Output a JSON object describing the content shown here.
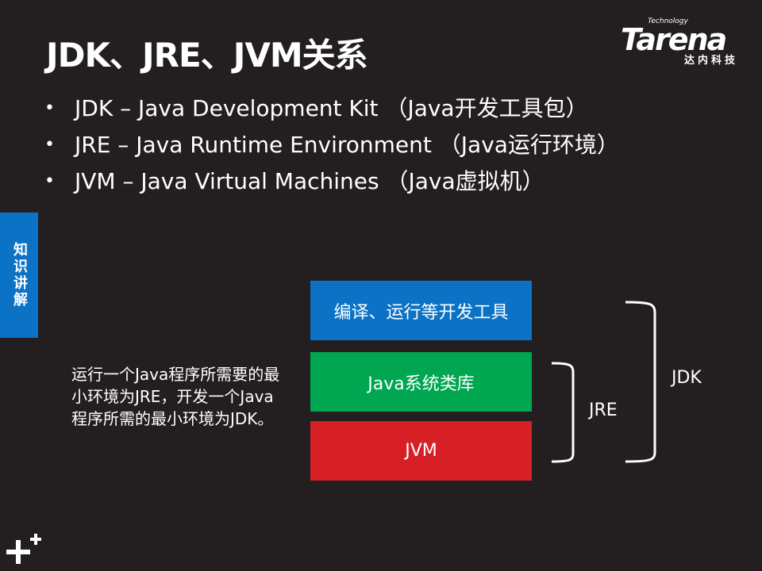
{
  "slide": {
    "title": "JDK、JRE、JVM关系",
    "bullets": [
      "JDK – Java Development Kit （Java开发工具包）",
      "JRE – Java Runtime Environment （Java运行环境）",
      "JVM – Java Virtual Machines （Java虚拟机）"
    ],
    "side_tab": "知识讲解",
    "note": "运行一个Java程序所需要的最小环境为JRE，开发一个Java程序所需的最小环境为JDK。"
  },
  "logo": {
    "top": "Technology",
    "main": "Tarena",
    "sub": "达内科技"
  },
  "diagram": {
    "boxes": {
      "tools": "编译、运行等开发工具",
      "lib": "Java系统类库",
      "jvm": "JVM"
    },
    "labels": {
      "jre": "JRE",
      "jdk": "JDK"
    }
  },
  "colors": {
    "background": "#231f20",
    "blue": "#0b72c6",
    "green": "#00a650",
    "red": "#d71f26"
  },
  "icons": {
    "corner": "plus-icon"
  }
}
